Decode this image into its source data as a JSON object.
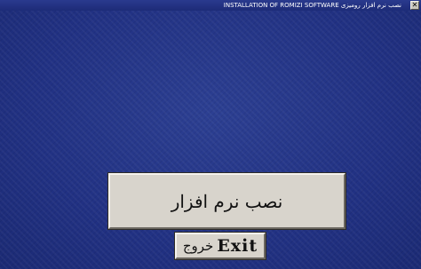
{
  "window": {
    "title": "INSTALLATION OF ROMIZI SOFTWARE     نصب نرم افزار رومیزی",
    "close_label": "✕"
  },
  "main": {
    "install_label": "نصب نرم افزار",
    "exit_persian": "خروج",
    "exit_english": "Exit"
  }
}
